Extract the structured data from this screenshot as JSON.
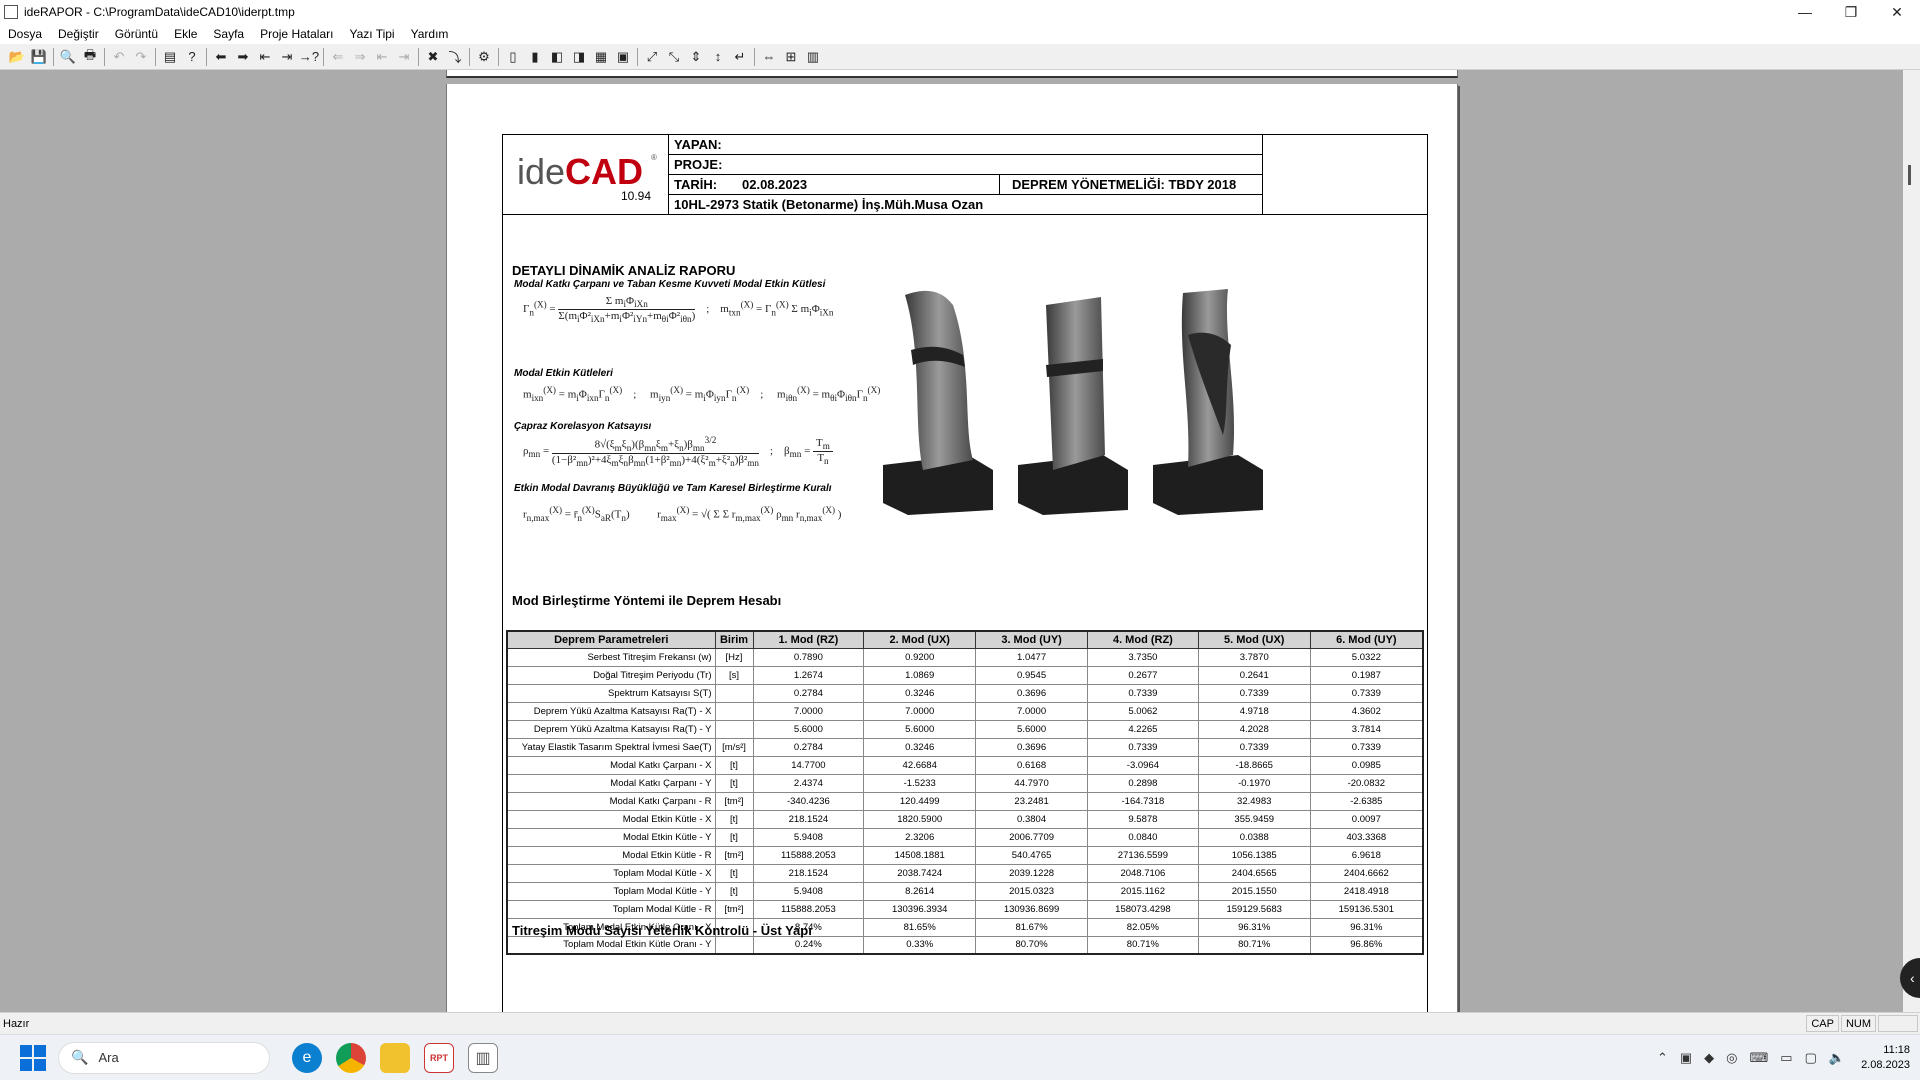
{
  "window": {
    "title": "ideRAPOR - C:\\ProgramData\\ideCAD10\\iderpt.tmp"
  },
  "menu": [
    "Dosya",
    "Değiştir",
    "Görüntü",
    "Ekle",
    "Sayfa",
    "Proje Hataları",
    "Yazı Tipi",
    "Yardım"
  ],
  "report": {
    "logo": {
      "ide": "ide",
      "cad": "CAD",
      "reg": "®",
      "version": "10.94"
    },
    "header": {
      "yapan": "YAPAN:",
      "proje": "PROJE:",
      "tarih_label": "TARİH:",
      "tarih": "02.08.2023",
      "yonetmelik": "DEPREM YÖNETMELİĞİ: TBDY 2018",
      "project_line": "10HL-2973 Statik (Betonarme) İnş.Müh.Musa Ozan"
    },
    "title": "DETAYLI DİNAMİK ANALİZ RAPORU",
    "formula_titles": [
      "Modal Katkı Çarpanı ve Taban Kesme Kuvveti Modal Etkin Kütlesi",
      "Modal Etkin Kütleleri",
      "Çapraz Korelasyon Katsayısı",
      "Etkin Modal Davranış Büyüklüğü ve Tam Karesel Birleştirme Kuralı"
    ],
    "section1": "Mod Birleştirme Yöntemi ile Deprem Hesabı",
    "section2": "Titreşim Modu Sayısı Yeterlik Kontrolü - Üst Yapı",
    "table": {
      "headers": [
        "Deprem Parametreleri",
        "Birim",
        "1. Mod (RZ)",
        "2. Mod (UX)",
        "3. Mod (UY)",
        "4. Mod (RZ)",
        "5. Mod (UX)",
        "6. Mod (UY)"
      ],
      "rows": [
        [
          "Serbest Titreşim Frekansı (w)",
          "[Hz]",
          "0.7890",
          "0.9200",
          "1.0477",
          "3.7350",
          "3.7870",
          "5.0322"
        ],
        [
          "Doğal Titreşim Periyodu (Tr)",
          "[s]",
          "1.2674",
          "1.0869",
          "0.9545",
          "0.2677",
          "0.2641",
          "0.1987"
        ],
        [
          "Spektrum Katsayısı S(T)",
          "",
          "0.2784",
          "0.3246",
          "0.3696",
          "0.7339",
          "0.7339",
          "0.7339"
        ],
        [
          "Deprem Yükü Azaltma Katsayısı Ra(T) - X",
          "",
          "7.0000",
          "7.0000",
          "7.0000",
          "5.0062",
          "4.9718",
          "4.3602"
        ],
        [
          "Deprem Yükü Azaltma Katsayısı Ra(T) - Y",
          "",
          "5.6000",
          "5.6000",
          "5.6000",
          "4.2265",
          "4.2028",
          "3.7814"
        ],
        [
          "Yatay Elastik Tasarım Spektral İvmesi Sae(T)",
          "[m/s²]",
          "0.2784",
          "0.3246",
          "0.3696",
          "0.7339",
          "0.7339",
          "0.7339"
        ],
        [
          "Modal Katkı Çarpanı - X",
          "[t]",
          "14.7700",
          "42.6684",
          "0.6168",
          "-3.0964",
          "-18.8665",
          "0.0985"
        ],
        [
          "Modal Katkı Çarpanı - Y",
          "[t]",
          "2.4374",
          "-1.5233",
          "44.7970",
          "0.2898",
          "-0.1970",
          "-20.0832"
        ],
        [
          "Modal Katkı Çarpanı - R",
          "[tm²]",
          "-340.4236",
          "120.4499",
          "23.2481",
          "-164.7318",
          "32.4983",
          "-2.6385"
        ],
        [
          "Modal Etkin Kütle - X",
          "[t]",
          "218.1524",
          "1820.5900",
          "0.3804",
          "9.5878",
          "355.9459",
          "0.0097"
        ],
        [
          "Modal Etkin Kütle - Y",
          "[t]",
          "5.9408",
          "2.3206",
          "2006.7709",
          "0.0840",
          "0.0388",
          "403.3368"
        ],
        [
          "Modal Etkin Kütle - R",
          "[tm²]",
          "115888.2053",
          "14508.1881",
          "540.4765",
          "27136.5599",
          "1056.1385",
          "6.9618"
        ],
        [
          "Toplam Modal Kütle - X",
          "[t]",
          "218.1524",
          "2038.7424",
          "2039.1228",
          "2048.7106",
          "2404.6565",
          "2404.6662"
        ],
        [
          "Toplam Modal Kütle - Y",
          "[t]",
          "5.9408",
          "8.2614",
          "2015.0323",
          "2015.1162",
          "2015.1550",
          "2418.4918"
        ],
        [
          "Toplam Modal Kütle - R",
          "[tm²]",
          "115888.2053",
          "130396.3934",
          "130936.8699",
          "158073.4298",
          "159129.5683",
          "159136.5301"
        ],
        [
          "Toplam Modal Etkin Kütle Oranı - X",
          "",
          "8.74%",
          "81.65%",
          "81.67%",
          "82.05%",
          "96.31%",
          "96.31%"
        ],
        [
          "Toplam Modal Etkin Kütle Oranı - Y",
          "",
          "0.24%",
          "0.33%",
          "80.70%",
          "80.71%",
          "80.71%",
          "96.86%"
        ]
      ]
    }
  },
  "status": {
    "text": "Hazır",
    "cap": "CAP",
    "num": "NUM"
  },
  "taskbar": {
    "search_placeholder": "Ara",
    "time": "11:18",
    "date": "2.08.2023"
  }
}
